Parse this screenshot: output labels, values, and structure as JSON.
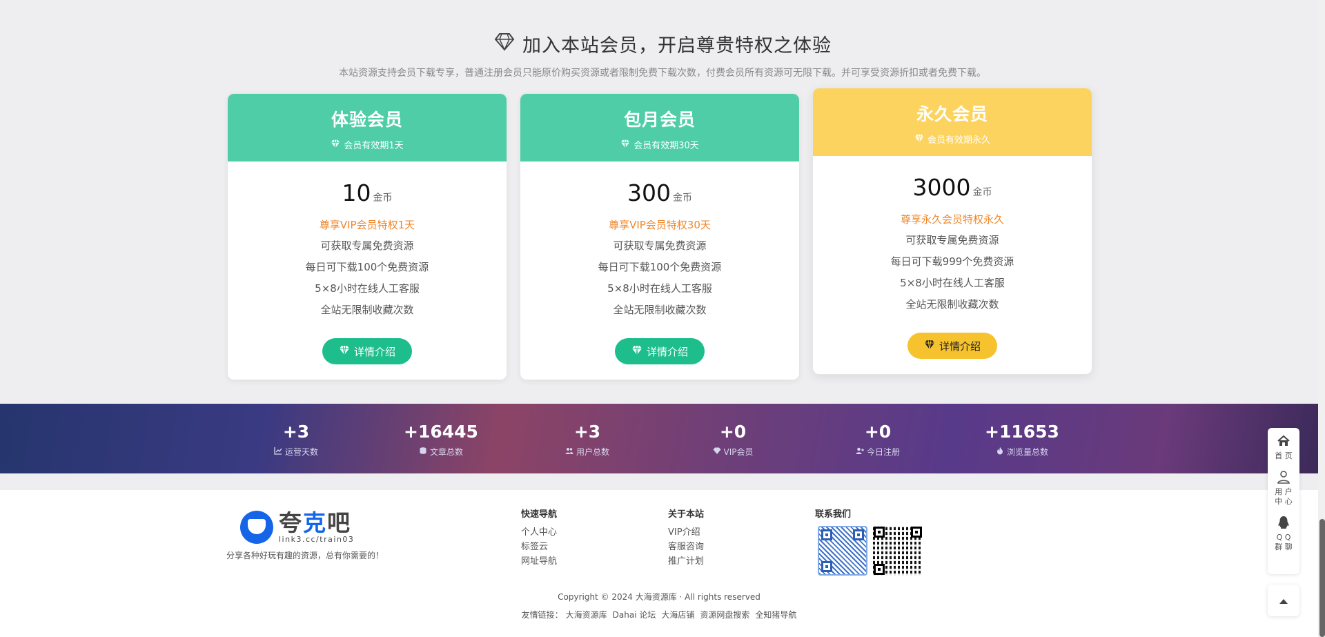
{
  "header": {
    "title": "加入本站会员，开启尊贵特权之体验",
    "description": "本站资源支持会员下载专享，普通注册会员只能原价购买资源或者限制免费下载次数，付费会员所有资源可无限下载。并可享受资源折扣或者免费下载。"
  },
  "plans": [
    {
      "name": "体验会员",
      "validity": "会员有效期1天",
      "price": "10",
      "unit": "金币",
      "lead": "尊享VIP会员特权1天",
      "perks": [
        "可获取专属免费资源",
        "每日可下载100个免费资源",
        "5×8小时在线人工客服",
        "全站无限制收藏次数"
      ],
      "button": "详情介绍"
    },
    {
      "name": "包月会员",
      "validity": "会员有效期30天",
      "price": "300",
      "unit": "金币",
      "lead": "尊享VIP会员特权30天",
      "perks": [
        "可获取专属免费资源",
        "每日可下载100个免费资源",
        "5×8小时在线人工客服",
        "全站无限制收藏次数"
      ],
      "button": "详情介绍"
    },
    {
      "name": "永久会员",
      "validity": "会员有效期永久",
      "price": "3000",
      "unit": "金币",
      "lead": "尊享永久会员特权永久",
      "perks": [
        "可获取专属免费资源",
        "每日可下载999个免费资源",
        "5×8小时在线人工客服",
        "全站无限制收藏次数"
      ],
      "button": "详情介绍"
    }
  ],
  "stats": [
    {
      "value": "+3",
      "label": "运营天数",
      "icon": "chart-icon"
    },
    {
      "value": "+16445",
      "label": "文章总数",
      "icon": "database-icon"
    },
    {
      "value": "+3",
      "label": "用户总数",
      "icon": "users-icon"
    },
    {
      "value": "+0",
      "label": "VIP会员",
      "icon": "diamond-icon"
    },
    {
      "value": "+0",
      "label": "今日注册",
      "icon": "user-plus-icon"
    },
    {
      "value": "+11653",
      "label": "浏览量总数",
      "icon": "fire-icon"
    }
  ],
  "footer": {
    "logo_main_a": "夸",
    "logo_main_b": "克",
    "logo_main_c": "吧",
    "logo_sub": "link3.cc/train03",
    "tagline": "分享各种好玩有趣的资源，总有你需要的！",
    "columns": [
      {
        "title": "快速导航",
        "links": [
          "个人中心",
          "标签云",
          "网址导航"
        ]
      },
      {
        "title": "关于本站",
        "links": [
          "VIP介绍",
          "客服咨询",
          "推广计划"
        ]
      },
      {
        "title": "联系我们",
        "links": []
      }
    ],
    "copyright": "Copyright © 2024 大海资源库 · All rights reserved",
    "friend_label": "友情链接：",
    "friend_links": [
      "大海资源库",
      "Dahai 论坛",
      "大海店铺",
      "资源网盘搜索",
      "全知猪导航"
    ]
  },
  "sidebar": {
    "home": "首 页",
    "user_a": "用 户",
    "user_b": "中 心",
    "qq_a": "Q Q",
    "qq_b": "群 聊"
  },
  "colors": {
    "green_header": "#4ecda6",
    "gold_header": "#fcd35e",
    "green_button": "#1ebe8c",
    "gold_button": "#f6c22e",
    "lead_orange": "#f0862a"
  }
}
